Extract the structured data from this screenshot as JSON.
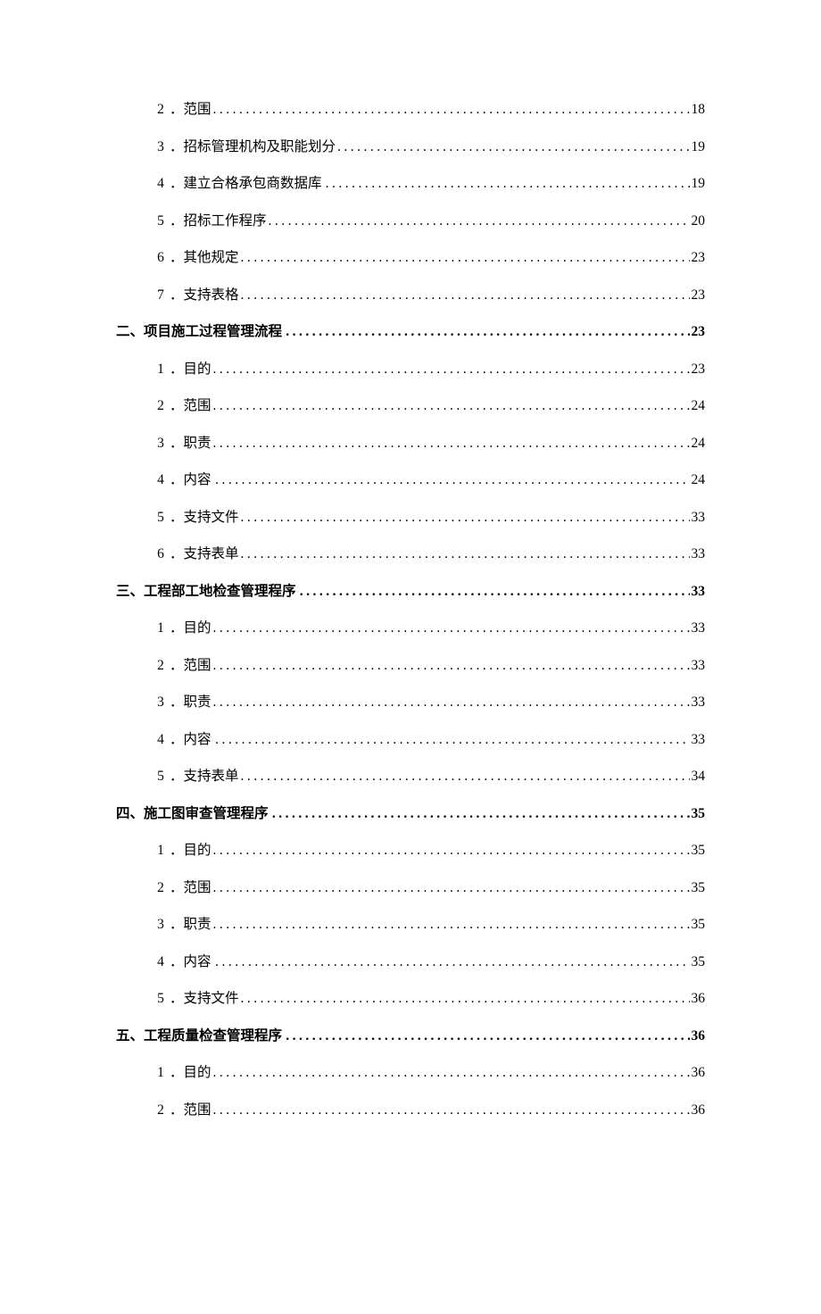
{
  "toc": [
    {
      "level": "sub",
      "num": "2",
      "sep": "．",
      "title": "范围",
      "page": "18"
    },
    {
      "level": "sub",
      "num": "3",
      "sep": "．",
      "title": "招标管理机构及职能划分",
      "page": "19"
    },
    {
      "level": "sub",
      "num": "4",
      "sep": "．",
      "title": "建立合格承包商数据库",
      "page": "19",
      "space_after_title": true
    },
    {
      "level": "sub",
      "num": "5",
      "sep": "．",
      "title": "招标工作程序",
      "page": "20"
    },
    {
      "level": "sub",
      "num": "6",
      "sep": "．",
      "title": "其他规定",
      "page": "23"
    },
    {
      "level": "sub",
      "num": "7",
      "sep": "．",
      "title": "支持表格",
      "page": "23"
    },
    {
      "level": "main",
      "num": "二、",
      "title": "项目施工过程管理流程",
      "page": "23",
      "space_after_title": true
    },
    {
      "level": "sub",
      "num": "1",
      "sep": "．",
      "title": "目的",
      "page": "23"
    },
    {
      "level": "sub",
      "num": "2",
      "sep": "．",
      "title": "范围",
      "page": "24"
    },
    {
      "level": "sub",
      "num": "3",
      "sep": "．",
      "title": "职责",
      "page": "24"
    },
    {
      "level": "sub",
      "num": "4",
      "sep": "．",
      "title": "内容",
      "page": "24",
      "space_after_title": true
    },
    {
      "level": "sub",
      "num": "5",
      "sep": "．",
      "title": "支持文件",
      "page": "33"
    },
    {
      "level": "sub",
      "num": "6",
      "sep": "．",
      "title": "支持表单",
      "page": "33"
    },
    {
      "level": "main",
      "num": "三、",
      "title": "工程部工地检查管理程序",
      "page": "33",
      "space_after_title": true
    },
    {
      "level": "sub",
      "num": "1",
      "sep": "．",
      "title": "目的",
      "page": "33"
    },
    {
      "level": "sub",
      "num": "2",
      "sep": "．",
      "title": "范围",
      "page": "33"
    },
    {
      "level": "sub",
      "num": "3",
      "sep": "．",
      "title": "职责",
      "page": "33"
    },
    {
      "level": "sub",
      "num": "4",
      "sep": "．",
      "title": "内容",
      "page": "33",
      "space_after_title": true
    },
    {
      "level": "sub",
      "num": "5",
      "sep": "．",
      "title": "支持表单",
      "page": "34"
    },
    {
      "level": "main",
      "num": "四、",
      "title": "施工图审查管理程序",
      "page": "35",
      "space_after_title": true
    },
    {
      "level": "sub",
      "num": "1",
      "sep": "．",
      "title": "目的",
      "page": "35"
    },
    {
      "level": "sub",
      "num": "2",
      "sep": "．",
      "title": "范围",
      "page": "35"
    },
    {
      "level": "sub",
      "num": "3",
      "sep": "．",
      "title": "职责",
      "page": "35"
    },
    {
      "level": "sub",
      "num": "4",
      "sep": "．",
      "title": "内容",
      "page": "35",
      "space_after_title": true
    },
    {
      "level": "sub",
      "num": "5",
      "sep": "．",
      "title": "支持文件",
      "page": "36"
    },
    {
      "level": "main",
      "num": "五、",
      "title": "工程质量检查管理程序",
      "page": "36",
      "space_after_title": true
    },
    {
      "level": "sub",
      "num": "1",
      "sep": "．",
      "title": "目的",
      "page": "36"
    },
    {
      "level": "sub",
      "num": "2",
      "sep": "．",
      "title": "范围",
      "page": "36"
    }
  ]
}
